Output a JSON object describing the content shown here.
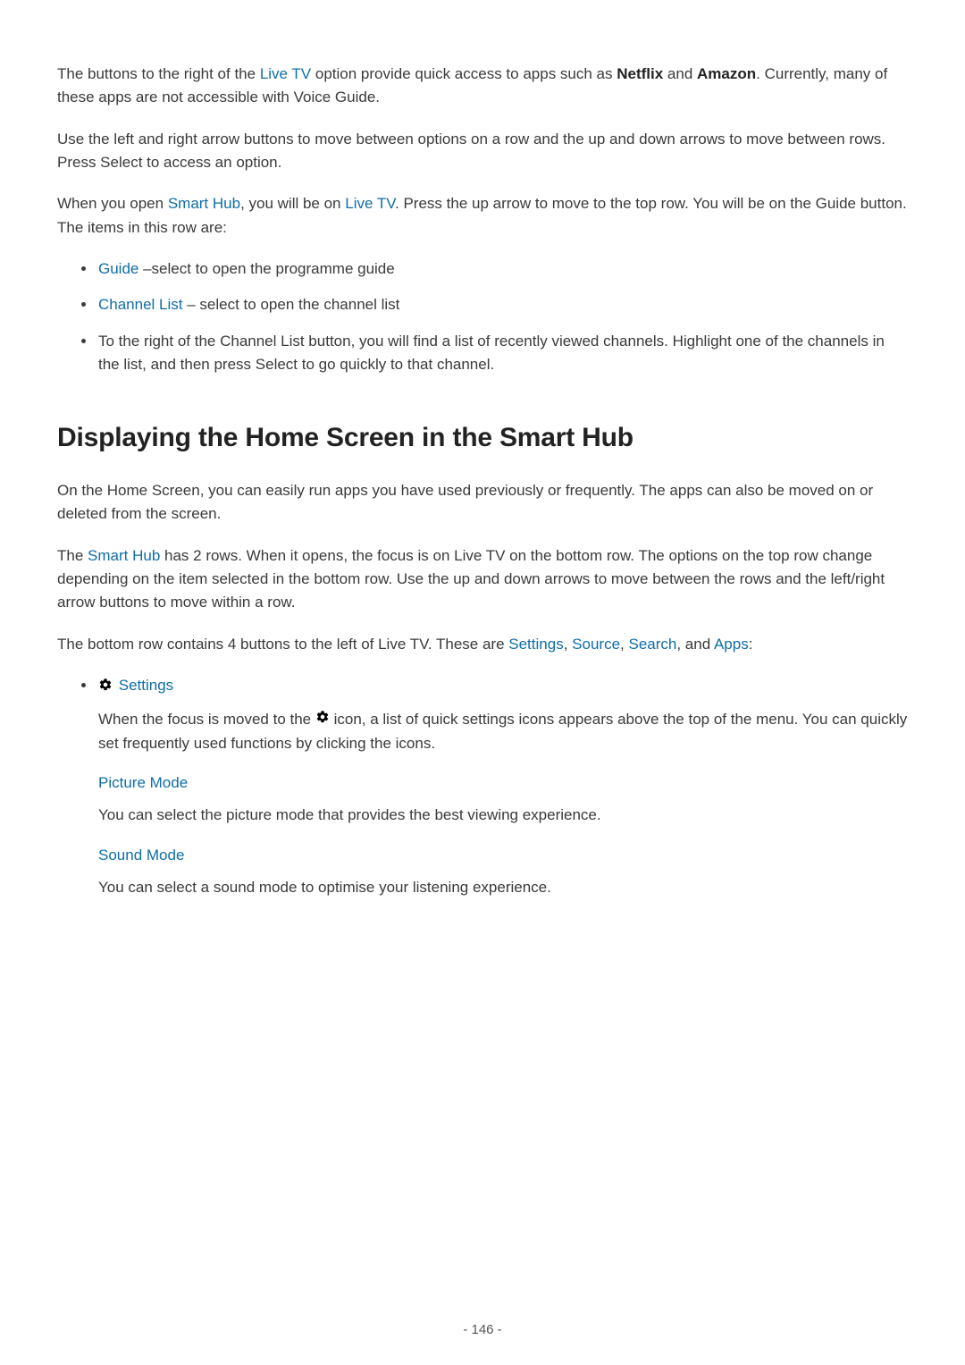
{
  "p1": {
    "t1": "The buttons to the right of the ",
    "link1": "Live TV",
    "t2": " option provide quick access to apps such as ",
    "bold1": "Netflix",
    "t3": " and ",
    "bold2": "Amazon",
    "t4": ". Currently, many of these apps are not accessible with Voice Guide."
  },
  "p2": "Use the left and right arrow buttons to move between options on a row and the up and down arrows to move between rows. Press Select to access an option.",
  "p3": {
    "t1": "When you open ",
    "link1": "Smart Hub",
    "t2": ", you will be on ",
    "link2": "Live TV",
    "t3": ". Press the up arrow to move to the top row. You will be on the Guide button. The items in this row are:"
  },
  "list1": {
    "i1": {
      "link": "Guide",
      "text": " –select to open the programme guide"
    },
    "i2": {
      "link": "Channel List",
      "text": " – select to open the channel list"
    },
    "i3": "To the right of the Channel List button, you will find a list of recently viewed channels. Highlight one of the channels in the list, and then press Select to go quickly to that channel."
  },
  "h2": "Displaying the Home Screen in the Smart Hub",
  "p4": "On the Home Screen, you can easily run apps you have used previously or frequently. The apps can also be moved on or deleted from the screen.",
  "p5": {
    "t1": "The ",
    "link1": "Smart Hub",
    "t2": " has 2 rows. When it opens, the focus is on Live TV on the bottom row. The options on the top row change depending on the item selected in the bottom row. Use the up and down arrows to move between the rows and the left/right arrow buttons to move within a row."
  },
  "p6": {
    "t1": "The bottom row contains 4 buttons to the left of Live TV. These are ",
    "l1": "Settings",
    "c1": ", ",
    "l2": "Source",
    "c2": ", ",
    "l3": "Search",
    "c3": ", and ",
    "l4": "Apps",
    "c4": ":"
  },
  "settings": {
    "title": "Settings",
    "desc": {
      "t1": "When the focus is moved to the ",
      "t2": " icon, a list of quick settings icons appears above the top of the menu. You can quickly set frequently used functions by clicking the icons."
    },
    "picture_mode": {
      "title": "Picture Mode",
      "desc": "You can select the picture mode that provides the best viewing experience."
    },
    "sound_mode": {
      "title": "Sound Mode",
      "desc": "You can select a sound mode to optimise your listening experience."
    }
  },
  "page_number": "- 146 -"
}
